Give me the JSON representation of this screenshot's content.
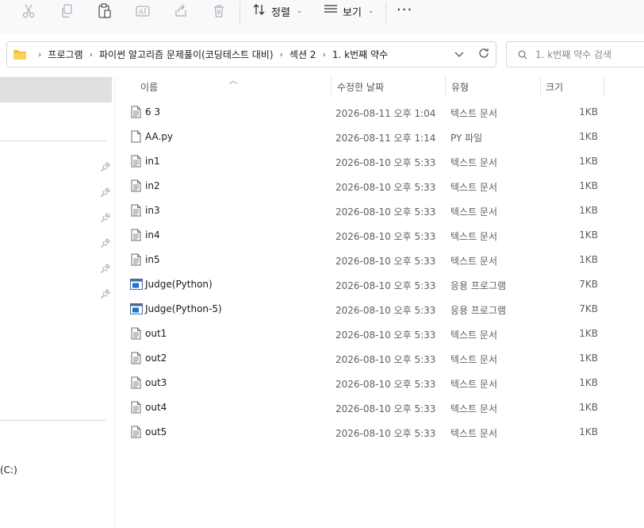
{
  "toolbar": {
    "icons": [
      "cut-icon",
      "copy-icon",
      "paste-icon",
      "rename-icon",
      "share-icon",
      "delete-icon"
    ],
    "sort_label": "정렬",
    "view_label": "보기",
    "more_label": "···"
  },
  "address": {
    "breadcrumbs": [
      "프로그램",
      "파이썬 알고리즘 문제풀이(코딩테스트 대비)",
      "섹션 2",
      "1. k번째 약수"
    ]
  },
  "search": {
    "placeholder": "1. k번째 약수 검색"
  },
  "nav": {
    "drive_label": "(C:)"
  },
  "columns": {
    "name": "이름",
    "date": "수정한 날짜",
    "type": "유형",
    "size": "크기"
  },
  "files": [
    {
      "name": "6 3",
      "date": "2026-08-11 오후 1:04",
      "type": "텍스트 문서",
      "size": "1KB",
      "icon": "text-file-icon"
    },
    {
      "name": "AA.py",
      "date": "2026-08-11 오후 1:14",
      "type": "PY 파일",
      "size": "1KB",
      "icon": "blank-file-icon"
    },
    {
      "name": "in1",
      "date": "2026-08-10 오후 5:33",
      "type": "텍스트 문서",
      "size": "1KB",
      "icon": "text-file-icon"
    },
    {
      "name": "in2",
      "date": "2026-08-10 오후 5:33",
      "type": "텍스트 문서",
      "size": "1KB",
      "icon": "text-file-icon"
    },
    {
      "name": "in3",
      "date": "2026-08-10 오후 5:33",
      "type": "텍스트 문서",
      "size": "1KB",
      "icon": "text-file-icon"
    },
    {
      "name": "in4",
      "date": "2026-08-10 오후 5:33",
      "type": "텍스트 문서",
      "size": "1KB",
      "icon": "text-file-icon"
    },
    {
      "name": "in5",
      "date": "2026-08-10 오후 5:33",
      "type": "텍스트 문서",
      "size": "1KB",
      "icon": "text-file-icon"
    },
    {
      "name": "Judge(Python)",
      "date": "2026-08-10 오후 5:33",
      "type": "응용 프로그램",
      "size": "7KB",
      "icon": "app-icon"
    },
    {
      "name": "Judge(Python-5)",
      "date": "2026-08-10 오후 5:33",
      "type": "응용 프로그램",
      "size": "7KB",
      "icon": "app-icon"
    },
    {
      "name": "out1",
      "date": "2026-08-10 오후 5:33",
      "type": "텍스트 문서",
      "size": "1KB",
      "icon": "text-file-icon"
    },
    {
      "name": "out2",
      "date": "2026-08-10 오후 5:33",
      "type": "텍스트 문서",
      "size": "1KB",
      "icon": "text-file-icon"
    },
    {
      "name": "out3",
      "date": "2026-08-10 오후 5:33",
      "type": "텍스트 문서",
      "size": "1KB",
      "icon": "text-file-icon"
    },
    {
      "name": "out4",
      "date": "2026-08-10 오후 5:33",
      "type": "텍스트 문서",
      "size": "1KB",
      "icon": "text-file-icon"
    },
    {
      "name": "out5",
      "date": "2026-08-10 오후 5:33",
      "type": "텍스트 문서",
      "size": "1KB",
      "icon": "text-file-icon"
    }
  ],
  "colors": {
    "selection": "#e0e0e0",
    "folder": "#f0c040",
    "app_blue": "#1e6fd0"
  }
}
